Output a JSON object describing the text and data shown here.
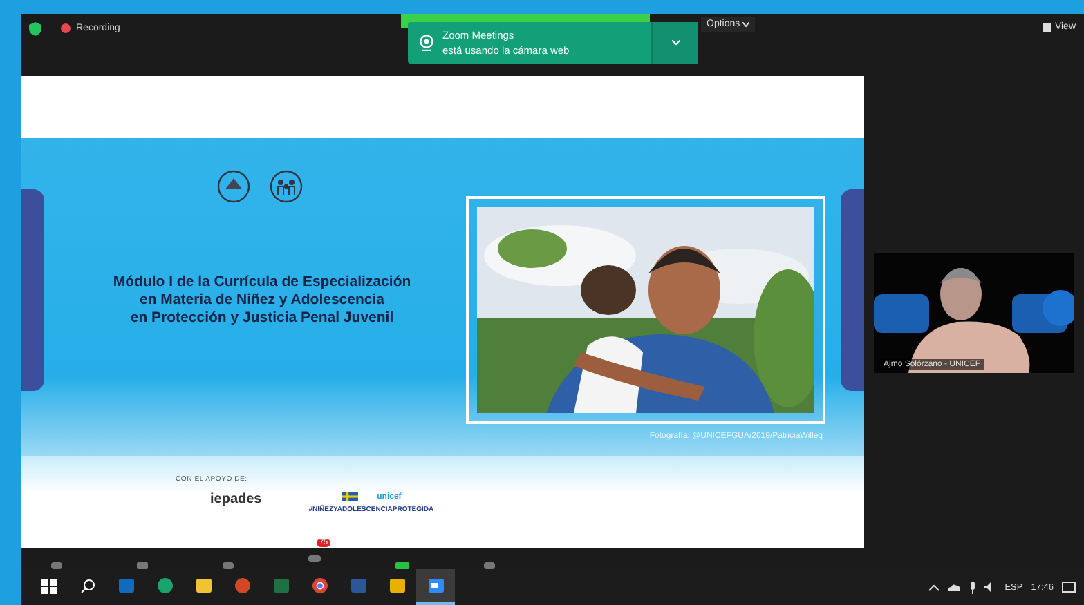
{
  "top_bar": {
    "recording": "Recording",
    "view_options": "Options",
    "view": "View"
  },
  "notification": {
    "title": "Zoom Meetings",
    "message": "está usando la cámara web"
  },
  "slide": {
    "title_lines": [
      "Módulo I de la Currícula de Especialización",
      "en Materia de Niñez y Adolescencia",
      "en Protección y Justicia Penal Juvenil"
    ],
    "photo_credit": "Fotografía: @UNICEFGUA/2019/PatriciaWilleq",
    "support_label": "CON EL APOYO DE:",
    "logos": [
      "iepades",
      "unicef"
    ],
    "hashtag": "#NIÑEZYADOLESCENCIAPROTEGIDA"
  },
  "video_tile": {
    "name": "Ajmo Solórzano - UNICEF"
  },
  "meeting_toolbar": {
    "chat_badge": "75"
  },
  "taskbar": {
    "apps": [
      {
        "kind": "outlook",
        "selected": false
      },
      {
        "kind": "edge",
        "selected": false
      },
      {
        "kind": "explorer",
        "selected": false
      },
      {
        "kind": "powerpoint",
        "selected": false
      },
      {
        "kind": "excel",
        "selected": false
      },
      {
        "kind": "chrome",
        "selected": false
      },
      {
        "kind": "word",
        "selected": false
      },
      {
        "kind": "files",
        "selected": false
      },
      {
        "kind": "zoom",
        "selected": true
      }
    ],
    "language": "ESP",
    "time": "17:46"
  }
}
